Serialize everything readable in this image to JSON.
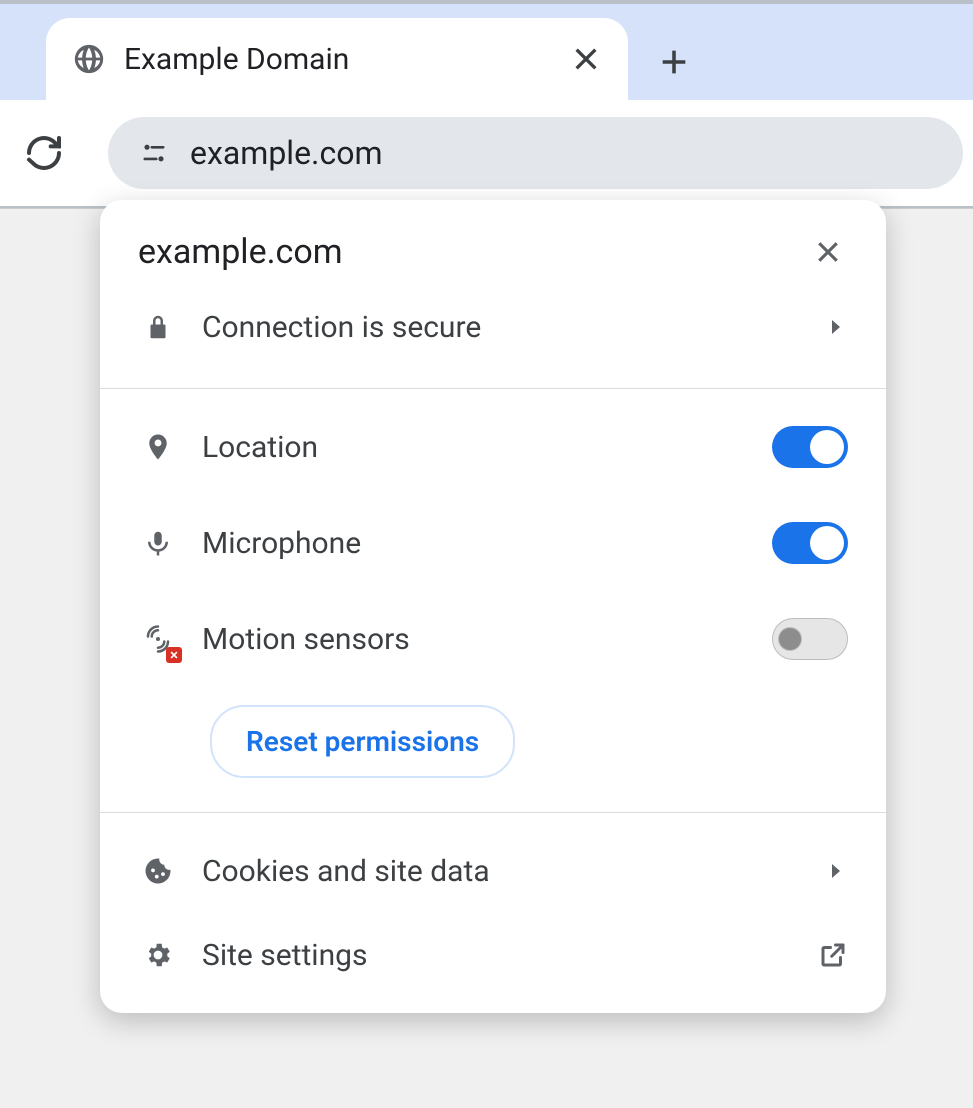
{
  "tabstrip": {
    "tabs": [
      {
        "title": "Example Domain"
      }
    ]
  },
  "toolbar": {
    "url": "example.com"
  },
  "site_info": {
    "title": "example.com",
    "connection": {
      "label": "Connection is secure"
    },
    "permissions": [
      {
        "id": "location",
        "label": "Location",
        "icon": "location-icon",
        "enabled": true
      },
      {
        "id": "microphone",
        "label": "Microphone",
        "icon": "microphone-icon",
        "enabled": true
      },
      {
        "id": "motion_sensors",
        "label": "Motion sensors",
        "icon": "motion-sensors-icon",
        "enabled": false,
        "blocked_badge": true
      }
    ],
    "reset_button": "Reset permissions",
    "cookies": {
      "label": "Cookies and site data"
    },
    "site_settings": {
      "label": "Site settings"
    }
  }
}
